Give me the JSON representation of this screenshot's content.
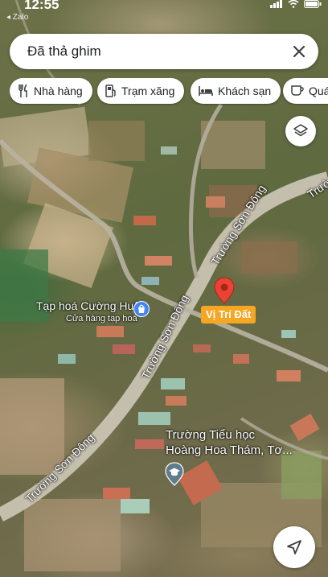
{
  "status_bar": {
    "time": "12:55",
    "back_app": "◂ Zalo"
  },
  "search": {
    "query": "Đã thả ghim"
  },
  "chips": [
    {
      "label": "Nhà hàng",
      "icon": "restaurant-icon"
    },
    {
      "label": "Trạm xăng",
      "icon": "gas-station-icon"
    },
    {
      "label": "Khách sạn",
      "icon": "hotel-icon"
    },
    {
      "label": "Quán",
      "icon": "cafe-icon"
    }
  ],
  "map": {
    "roads": [
      {
        "name": "Trường Sơn Đông"
      },
      {
        "name": "Trường Sơn Đông"
      },
      {
        "name": "Trường Sơn Đông"
      },
      {
        "name": "Trườ"
      }
    ],
    "places": {
      "shop_name": "Tạp hoá Cường Huệ",
      "shop_category": "Cửa hàng tạp hoá",
      "pin_label": "Vị Trí Đất",
      "school_line1": "Trường Tiểu học",
      "school_line2": "Hoàng Hoa Thám, Tơ..."
    }
  },
  "colors": {
    "pin_red": "#ea4335",
    "pin_label_bg": "#f5a623"
  }
}
